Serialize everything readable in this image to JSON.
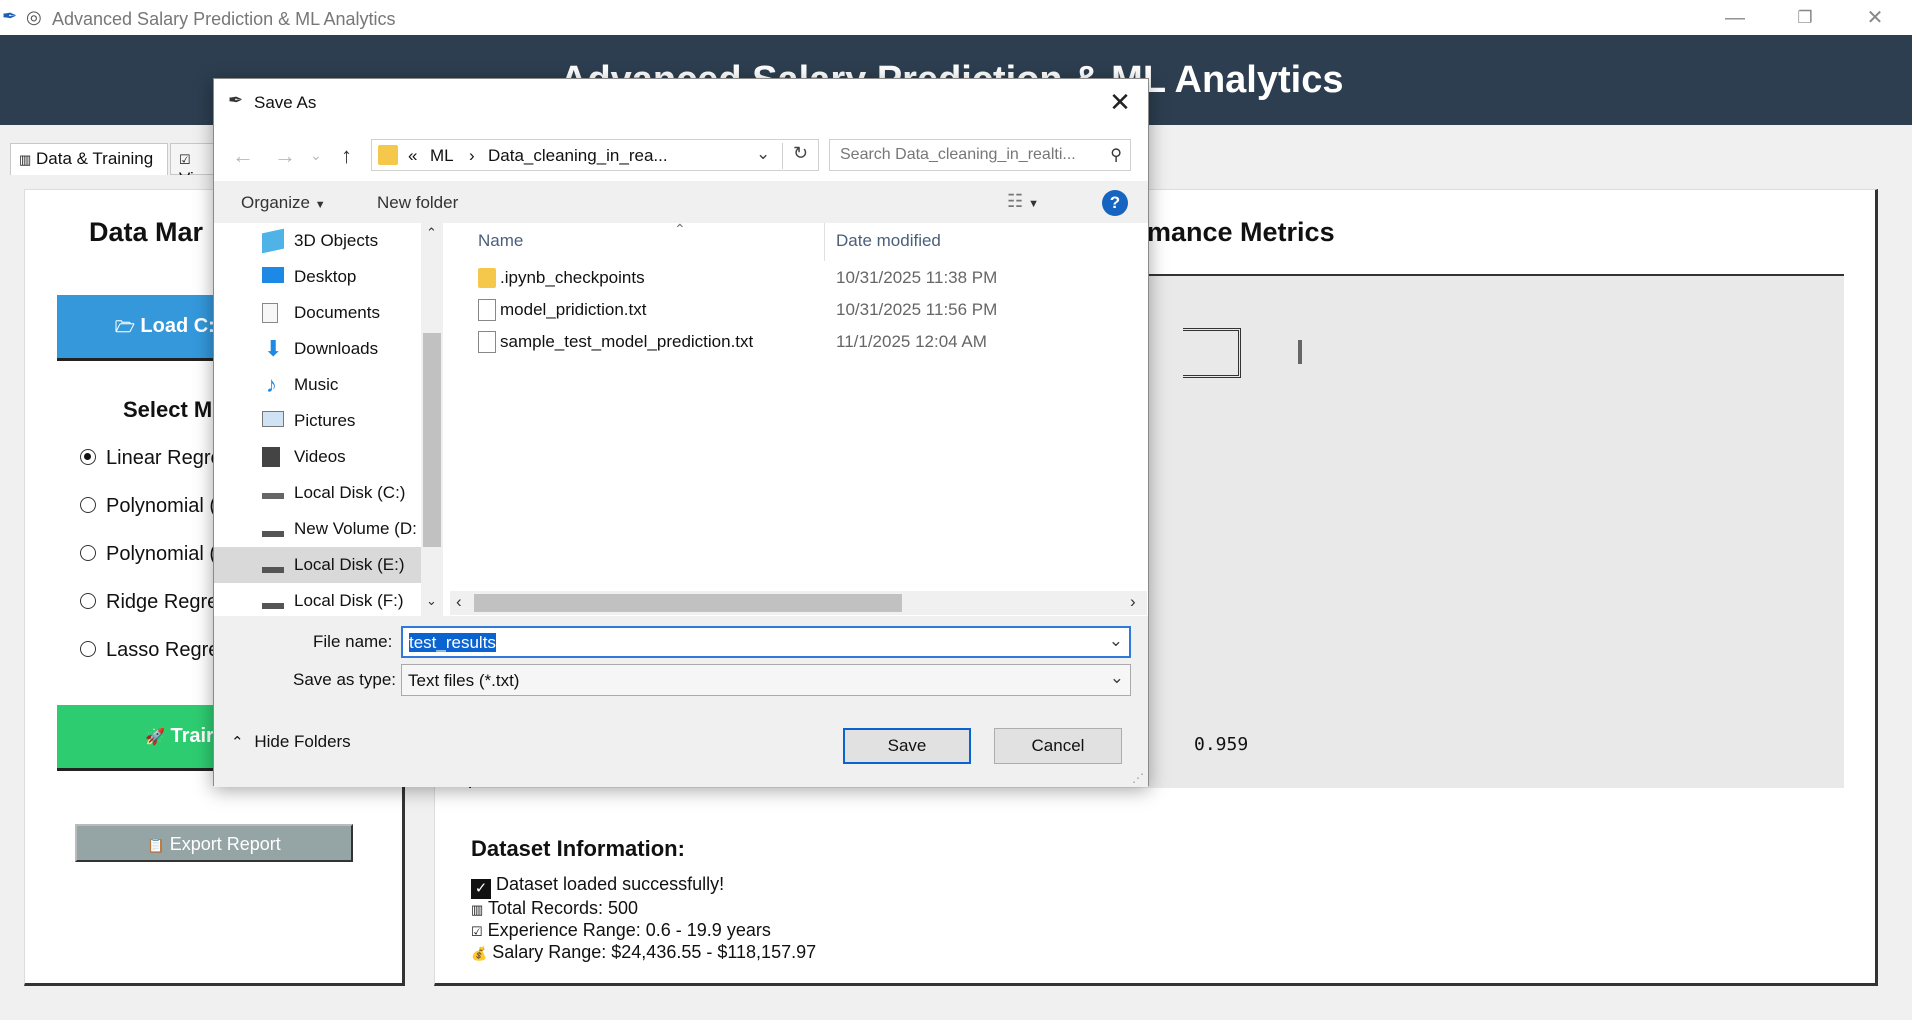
{
  "window": {
    "title": "Advanced Salary Prediction & ML Analytics"
  },
  "header": {
    "title": "Advanced Salary Prediction & ML Analytics"
  },
  "tabs": [
    {
      "label": "Data & Training",
      "active": true
    },
    {
      "label": "Vi",
      "active": false
    }
  ],
  "left_panel": {
    "title": "Data Mar",
    "load_button": "Load C:",
    "select_heading": "Select M",
    "models": [
      {
        "label": "Linear Regre",
        "selected": true
      },
      {
        "label": "Polynomial (",
        "selected": false
      },
      {
        "label": "Polynomial (",
        "selected": false
      },
      {
        "label": "Ridge Regre",
        "selected": false
      },
      {
        "label": "Lasso Regre",
        "selected": false
      }
    ],
    "train_button": "Trair",
    "export_button": "Export Report"
  },
  "right_panel": {
    "title": "mance Metrics",
    "metric_value": "0.959",
    "dataset_title": "Dataset Information:",
    "dataset_lines": [
      "Dataset loaded successfully!",
      "Total Records: 500",
      "Experience Range: 0.6 - 19.9 years",
      "Salary Range: $24,436.55 - $118,157.97"
    ]
  },
  "dialog": {
    "title": "Save As",
    "address": {
      "prefix": "«",
      "parts": [
        "ML",
        "Data_cleaning_in_rea..."
      ]
    },
    "search_placeholder": "Search Data_cleaning_in_realti...",
    "toolbar": {
      "organize": "Organize",
      "new_folder": "New folder"
    },
    "nav_items": [
      {
        "label": "3D Objects",
        "icon": "3d-objects-icon"
      },
      {
        "label": "Desktop",
        "icon": "desktop-icon"
      },
      {
        "label": "Documents",
        "icon": "documents-icon"
      },
      {
        "label": "Downloads",
        "icon": "downloads-icon"
      },
      {
        "label": "Music",
        "icon": "music-icon"
      },
      {
        "label": "Pictures",
        "icon": "pictures-icon"
      },
      {
        "label": "Videos",
        "icon": "videos-icon"
      },
      {
        "label": "Local Disk (C:)",
        "icon": "drive-c-icon"
      },
      {
        "label": "New Volume (D:",
        "icon": "drive-d-icon"
      },
      {
        "label": "Local Disk (E:)",
        "icon": "drive-e-icon",
        "selected": true
      },
      {
        "label": "Local Disk (F:)",
        "icon": "drive-f-icon"
      }
    ],
    "columns": {
      "name": "Name",
      "date": "Date modified"
    },
    "files": [
      {
        "name": ".ipynb_checkpoints",
        "date": "10/31/2025 11:38 PM",
        "type": "folder"
      },
      {
        "name": "model_pridiction.txt",
        "date": "10/31/2025 11:56 PM",
        "type": "file"
      },
      {
        "name": "sample_test_model_prediction.txt",
        "date": "11/1/2025 12:04 AM",
        "type": "file"
      }
    ],
    "file_name_label": "File name:",
    "file_name_value": "test_results",
    "save_type_label": "Save as type:",
    "save_type_value": "Text files (*.txt)",
    "hide_folders": "Hide Folders",
    "save_button": "Save",
    "cancel_button": "Cancel"
  },
  "colors": {
    "header_bg": "#2c3e50",
    "load_button": "#3498db",
    "train_button": "#2ecc71",
    "export_button": "#95a5a6",
    "selection": "#0a63d1"
  }
}
